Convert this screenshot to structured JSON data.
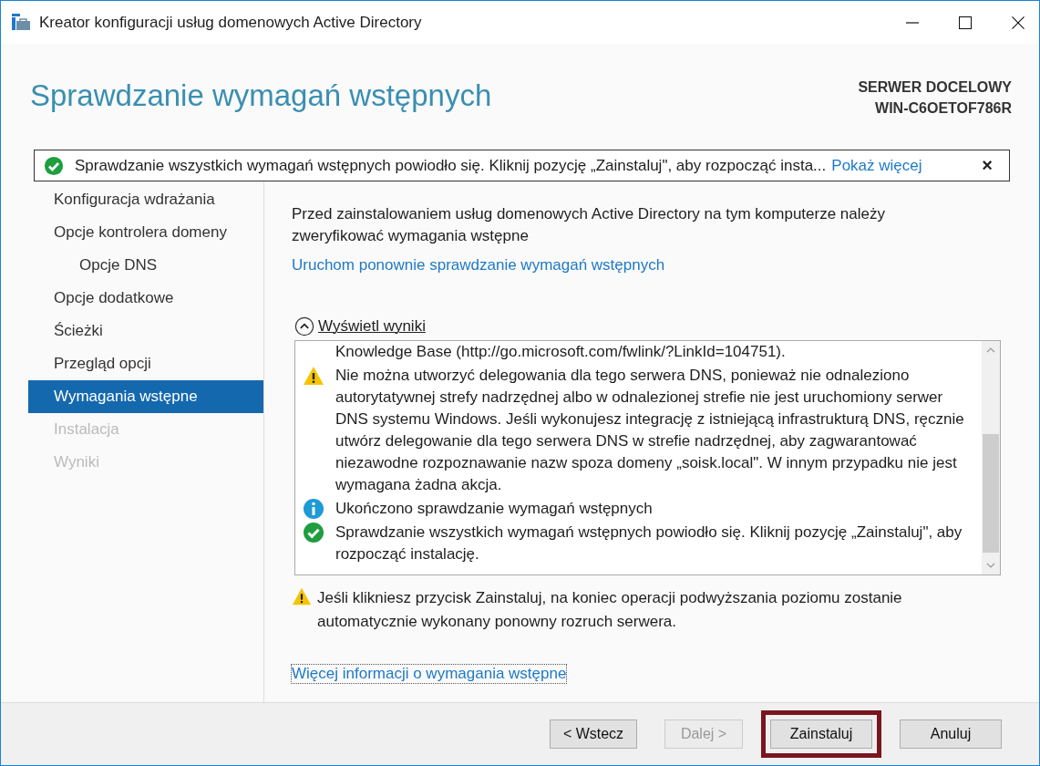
{
  "window": {
    "title": "Kreator konfiguracji usług domenowych Active Directory"
  },
  "header": {
    "title": "Sprawdzanie wymagań wstępnych",
    "server_label": "SERWER DOCELOWY",
    "server_name": "WIN-C6OETOF786R"
  },
  "notification": {
    "kind": "success",
    "text": "Sprawdzanie wszystkich wymagań wstępnych powiodło się. Kliknij pozycję „Zainstaluj\", aby rozpocząć insta...",
    "link": "Pokaż więcej",
    "close": "×"
  },
  "sidebar": {
    "items": [
      {
        "label": "Konfiguracja wdrażania",
        "selected": false,
        "disabled": false
      },
      {
        "label": "Opcje kontrolera domeny",
        "selected": false,
        "disabled": false,
        "children": [
          {
            "label": "Opcje DNS",
            "selected": false,
            "disabled": false
          }
        ]
      },
      {
        "label": "Opcje dodatkowe",
        "selected": false,
        "disabled": false
      },
      {
        "label": "Ścieżki",
        "selected": false,
        "disabled": false
      },
      {
        "label": "Przegląd opcji",
        "selected": false,
        "disabled": false
      },
      {
        "label": "Wymagania wstępne",
        "selected": true,
        "disabled": false
      },
      {
        "label": "Instalacja",
        "selected": false,
        "disabled": true
      },
      {
        "label": "Wyniki",
        "selected": false,
        "disabled": true
      }
    ]
  },
  "content": {
    "intro": "Przed zainstalowaniem usług domenowych Active Directory na tym komputerze należy zweryfikować wymagania wstępne",
    "rerun_link": "Uruchom ponownie sprawdzanie wymagań wstępnych",
    "results": {
      "toggle": "Wyświetl wyniki",
      "expanded": true,
      "messages": [
        {
          "kind": "text",
          "text": "Knowledge Base (http://go.microsoft.com/fwlink/?LinkId=104751)."
        },
        {
          "kind": "warning",
          "text": "Nie można utworzyć delegowania dla tego serwera DNS, ponieważ nie odnaleziono autorytatywnej strefy nadrzędnej albo w odnalezionej strefie nie jest uruchomiony serwer DNS systemu Windows. Jeśli wykonujesz integrację z istniejącą infrastrukturą DNS, ręcznie utwórz delegowanie dla tego serwera DNS w strefie nadrzędnej, aby zagwarantować niezawodne rozpoznawanie nazw spoza domeny „soisk.local\". W innym przypadku nie jest wymagana żadna akcja."
        },
        {
          "kind": "info",
          "text": "Ukończono sprawdzanie wymagań wstępnych"
        },
        {
          "kind": "success",
          "text": "Sprawdzanie wszystkich wymagań wstępnych powiodło się. Kliknij pozycję „Zainstaluj\", aby rozpocząć instalację."
        }
      ]
    },
    "restart_warning": {
      "kind": "warning",
      "text": "Jeśli klikniesz przycisk Zainstaluj, na koniec operacji podwyższania poziomu zostanie automatycznie wykonany ponowny rozruch serwera."
    },
    "more_info_link": "Więcej informacji o wymagania wstępne"
  },
  "buttons": [
    {
      "label": "< Wstecz",
      "disabled": false,
      "highlighted": false
    },
    {
      "label": "Dalej >",
      "disabled": true,
      "highlighted": false
    },
    {
      "label": "Zainstaluj",
      "disabled": false,
      "highlighted": true
    },
    {
      "label": "Anuluj",
      "disabled": false,
      "highlighted": false
    }
  ]
}
